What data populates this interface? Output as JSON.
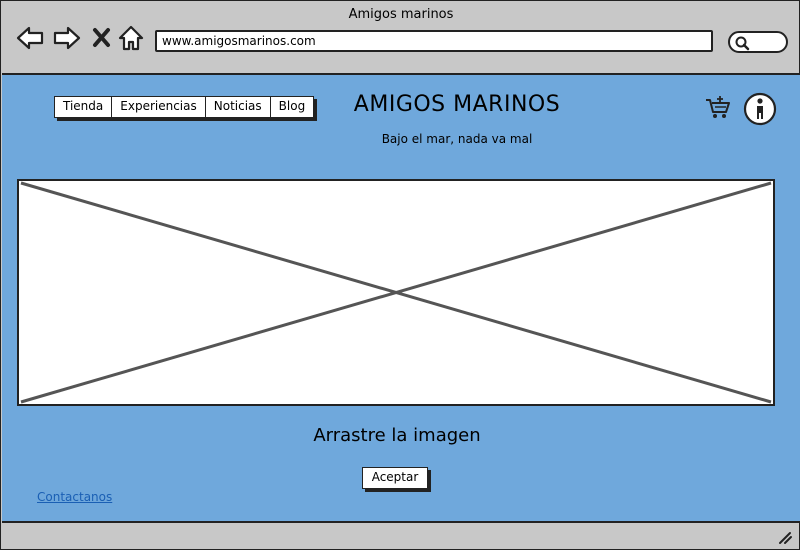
{
  "window": {
    "title": "Amigos marinos"
  },
  "browser": {
    "url": "www.amigosmarinos.com",
    "icons": [
      "back-arrow-icon",
      "forward-arrow-icon",
      "close-icon",
      "home-icon",
      "search-icon"
    ]
  },
  "header": {
    "nav": [
      {
        "label": "Tienda"
      },
      {
        "label": "Experiencias"
      },
      {
        "label": "Noticias"
      },
      {
        "label": "Blog"
      }
    ],
    "brand": "AMIGOS MARINOS",
    "tagline": "Bajo el mar, nada va mal",
    "icons": [
      "cart-icon",
      "user-icon"
    ]
  },
  "main": {
    "image_placeholder": "image-placeholder",
    "drag_text": "Arrastre la imagen",
    "accept_label": "Aceptar"
  },
  "footer": {
    "contact_label": "Contactanos"
  },
  "colors": {
    "content_bg": "#6fa8dc",
    "chrome_bg": "#c8c8c8",
    "link": "#1a5fb4"
  }
}
